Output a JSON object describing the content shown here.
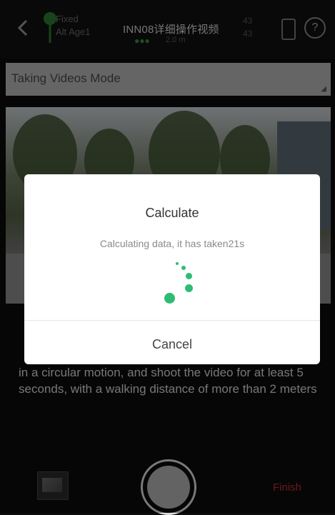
{
  "header": {
    "gps_status_line1": "Fixed",
    "gps_status_line2": "Alt Age1",
    "title": "INN08详细操作视频",
    "sub_indicator": "●●●",
    "sub_value": "2.0 m",
    "counter_top": "43",
    "counter_bottom": "43",
    "help_symbol": "?"
  },
  "mode_bar": {
    "label": "Taking Videos Mode"
  },
  "instructions": "in a circular motion, and shoot the video for at least 5 seconds, with a walking distance of more than 2 meters",
  "bottom": {
    "finish_label": "Finish"
  },
  "dialog": {
    "title": "Calculate",
    "message": "Calculating data, it has taken21s",
    "cancel_label": "Cancel"
  },
  "colors": {
    "accent": "#2ebc74",
    "finish": "#c03030"
  }
}
